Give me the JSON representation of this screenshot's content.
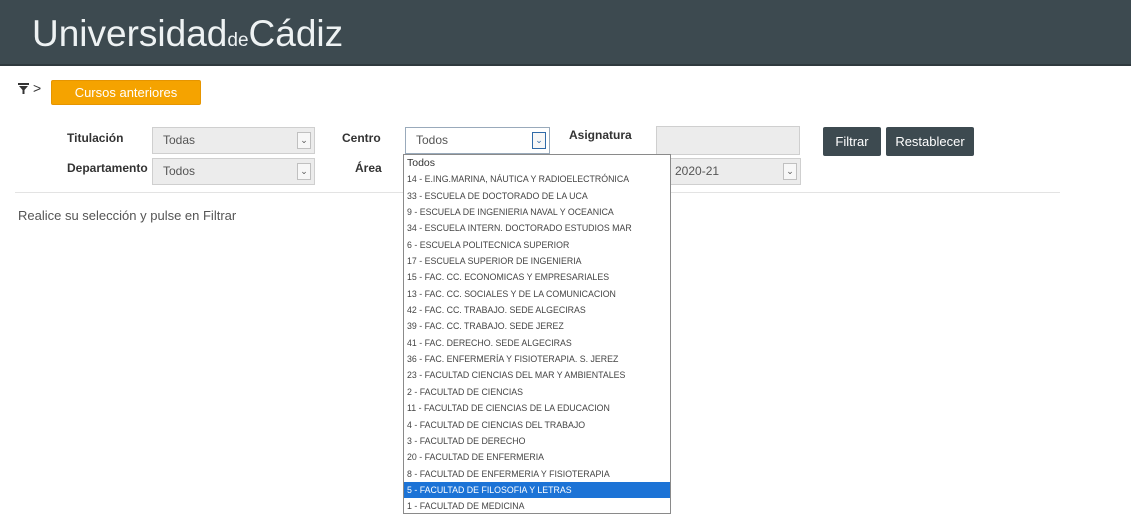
{
  "header": {
    "logo_part1": "Universidad",
    "logo_part2": "de",
    "logo_part3": "Cádiz"
  },
  "toolbar": {
    "breadcrumb_sep": ">",
    "cursos_label": "Cursos anteriores"
  },
  "filters": {
    "titulacion_label": "Titulación",
    "titulacion_value": "Todas",
    "centro_label": "Centro",
    "centro_value": "Todos",
    "asignatura_label": "Asignatura",
    "asignatura_value": "",
    "departamento_label": "Departamento",
    "departamento_value": "Todos",
    "area_label": "Área",
    "curso_value": "2020-21",
    "filtrar_label": "Filtrar",
    "restablecer_label": "Restablecer"
  },
  "info_text": "Realice su selección y pulse en Filtrar",
  "centro_options": [
    "Todos",
    "14 - E.ING.MARINA, NÁUTICA Y RADIOELECTRÓNICA",
    "33 - ESCUELA DE DOCTORADO DE LA UCA",
    "9 - ESCUELA DE INGENIERIA NAVAL Y OCEANICA",
    "34 - ESCUELA INTERN. DOCTORADO ESTUDIOS MAR",
    "6 - ESCUELA POLITECNICA SUPERIOR",
    "17 - ESCUELA SUPERIOR DE INGENIERIA",
    "15 - FAC. CC. ECONOMICAS Y EMPRESARIALES",
    "13 - FAC. CC. SOCIALES Y DE LA COMUNICACION",
    "42 - FAC. CC. TRABAJO. SEDE ALGECIRAS",
    "39 - FAC. CC. TRABAJO. SEDE JEREZ",
    "41 - FAC. DERECHO. SEDE ALGECIRAS",
    "36 - FAC. ENFERMERÍA Y FISIOTERAPIA. S. JEREZ",
    "23 - FACULTAD CIENCIAS DEL MAR Y AMBIENTALES",
    "2 - FACULTAD DE CIENCIAS",
    "11 - FACULTAD DE CIENCIAS DE LA EDUCACION",
    "4 - FACULTAD DE CIENCIAS DEL TRABAJO",
    "3 - FACULTAD DE DERECHO",
    "20 - FACULTAD DE ENFERMERIA",
    "8 - FACULTAD DE ENFERMERIA Y FISIOTERAPIA",
    "5 - FACULTAD DE FILOSOFIA Y LETRAS",
    "1 - FACULTAD DE MEDICINA"
  ],
  "centro_selected_index": 20
}
